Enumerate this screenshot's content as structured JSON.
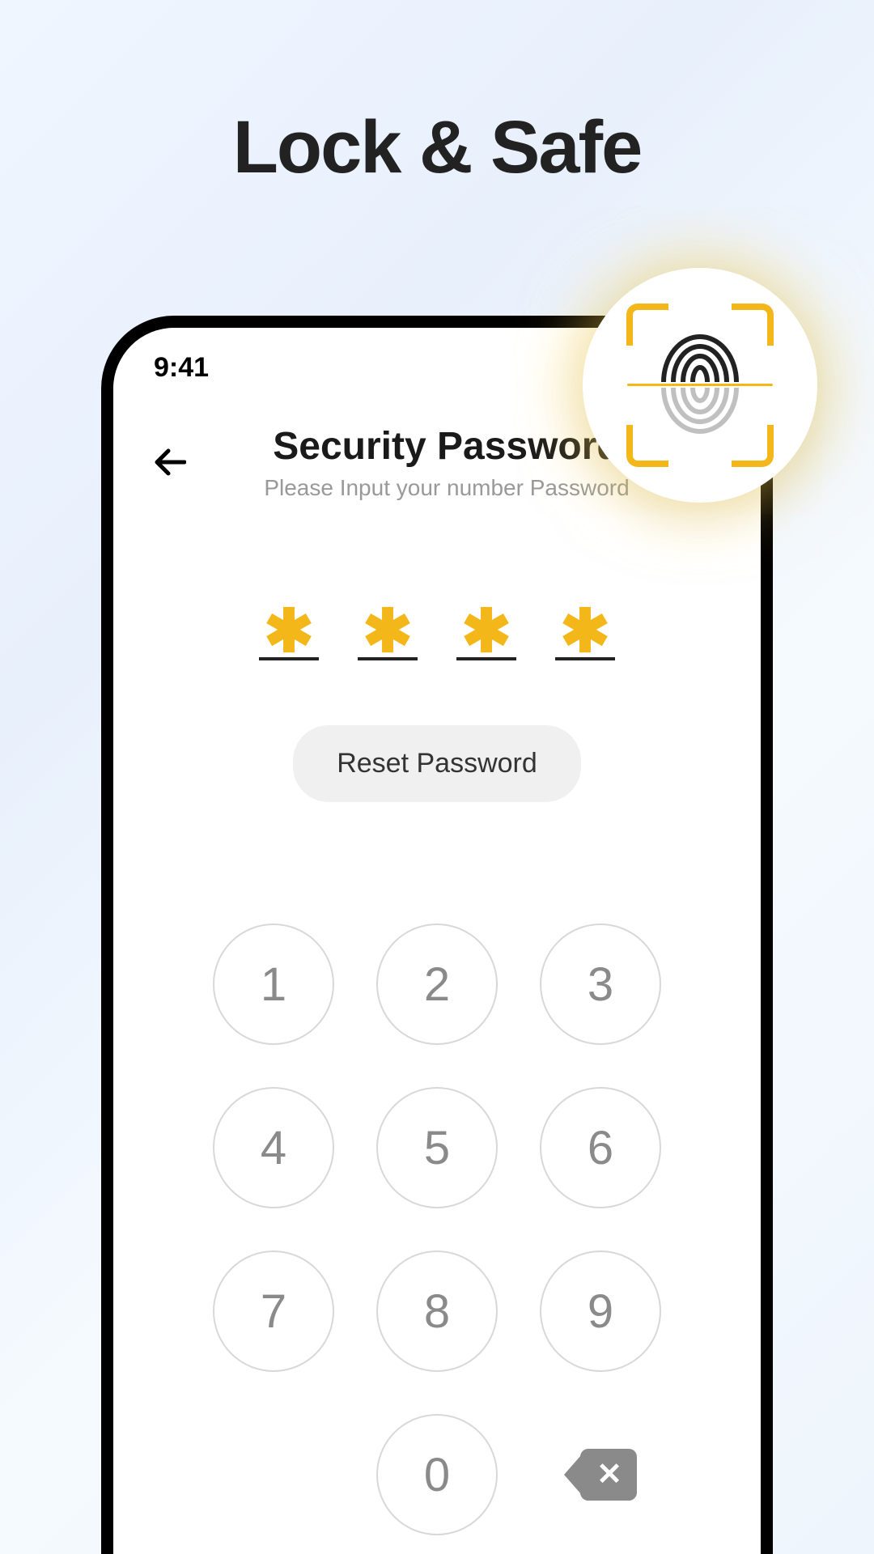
{
  "page": {
    "title": "Lock & Safe"
  },
  "statusBar": {
    "time": "9:41"
  },
  "header": {
    "title": "Security Password",
    "subtitle": "Please Input your number Password"
  },
  "password": {
    "maskChar": "✱",
    "slots": [
      "✱",
      "✱",
      "✱",
      "✱"
    ]
  },
  "actions": {
    "resetLabel": "Reset Password"
  },
  "keypad": {
    "keys": [
      "1",
      "2",
      "3",
      "4",
      "5",
      "6",
      "7",
      "8",
      "9",
      "",
      "0",
      "⌫"
    ]
  },
  "colors": {
    "accent": "#f3b71a",
    "textPrimary": "#1a1a1a",
    "textMuted": "#8a8a8a",
    "pillBg": "#f0f0f0"
  }
}
